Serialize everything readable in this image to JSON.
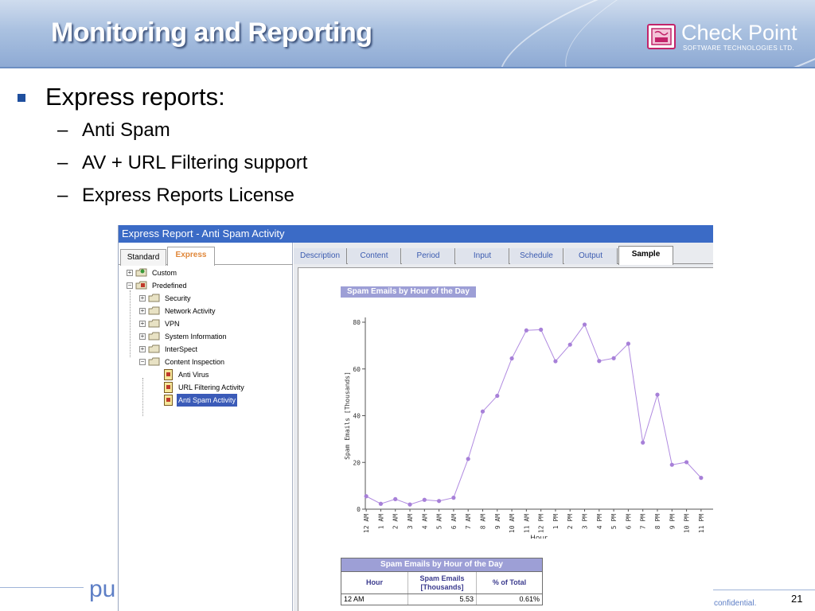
{
  "slide": {
    "title": "Monitoring and Reporting",
    "logo_name": "Check Point",
    "logo_sub": "SOFTWARE TECHNOLOGIES LTD.",
    "bullet": "Express reports:",
    "sub_bullets": [
      "Anti Spam",
      "AV + URL Filtering support",
      "Express Reports License"
    ],
    "footer_brand": "pu",
    "footer_confidential": "confidential.",
    "page_number": "21",
    "dash": "–"
  },
  "window": {
    "title": "Express Report - Anti Spam Activity",
    "left_tabs": [
      "Standard",
      "Express"
    ],
    "active_left_tab": "Express",
    "tree": {
      "custom": "Custom",
      "predefined": "Predefined",
      "security": "Security",
      "network_activity": "Network Activity",
      "vpn": "VPN",
      "system_information": "System Information",
      "interspect": "InterSpect",
      "content_inspection": "Content Inspection",
      "anti_virus": "Anti Virus",
      "url_filtering_activity": "URL Filtering Activity",
      "anti_spam_activity": "Anti Spam Activity"
    },
    "right_tabs": [
      "Description",
      "Content",
      "Period",
      "Input",
      "Schedule",
      "Output",
      "Sample"
    ],
    "active_right_tab": "Sample"
  },
  "chart_data": {
    "type": "line",
    "title": "Spam Emails by Hour of the Day",
    "xlabel": "Hour",
    "ylabel": "Spam Emails [Thousands]",
    "ylim": [
      0,
      80
    ],
    "yticks": [
      0,
      20,
      40,
      60,
      80
    ],
    "categories": [
      "12 AM",
      "1 AM",
      "2 AM",
      "3 AM",
      "4 AM",
      "5 AM",
      "6 AM",
      "7 AM",
      "8 AM",
      "9 AM",
      "10 AM",
      "11 AM",
      "12 PM",
      "1 PM",
      "2 PM",
      "3 PM",
      "4 PM",
      "5 PM",
      "6 PM",
      "7 PM",
      "8 PM",
      "9 PM",
      "10 PM",
      "11 PM"
    ],
    "values": [
      5.53,
      2.3,
      4.3,
      2.0,
      4.0,
      3.5,
      4.9,
      21.5,
      41.8,
      48.5,
      64.5,
      76.5,
      76.8,
      63.3,
      70.4,
      79.0,
      63.4,
      64.6,
      70.8,
      28.5,
      49.0,
      19.0,
      20.1,
      13.4
    ],
    "line_color": "#b08ae0",
    "marker_color": "#a780d8",
    "grid": false,
    "legend": "none"
  },
  "table": {
    "title": "Spam Emails by Hour of the Day",
    "headers": [
      "Hour",
      "Spam Emails [Thousands]",
      "% of Total"
    ],
    "rows": [
      [
        "12 AM",
        "5.53",
        "0.61%"
      ]
    ]
  }
}
